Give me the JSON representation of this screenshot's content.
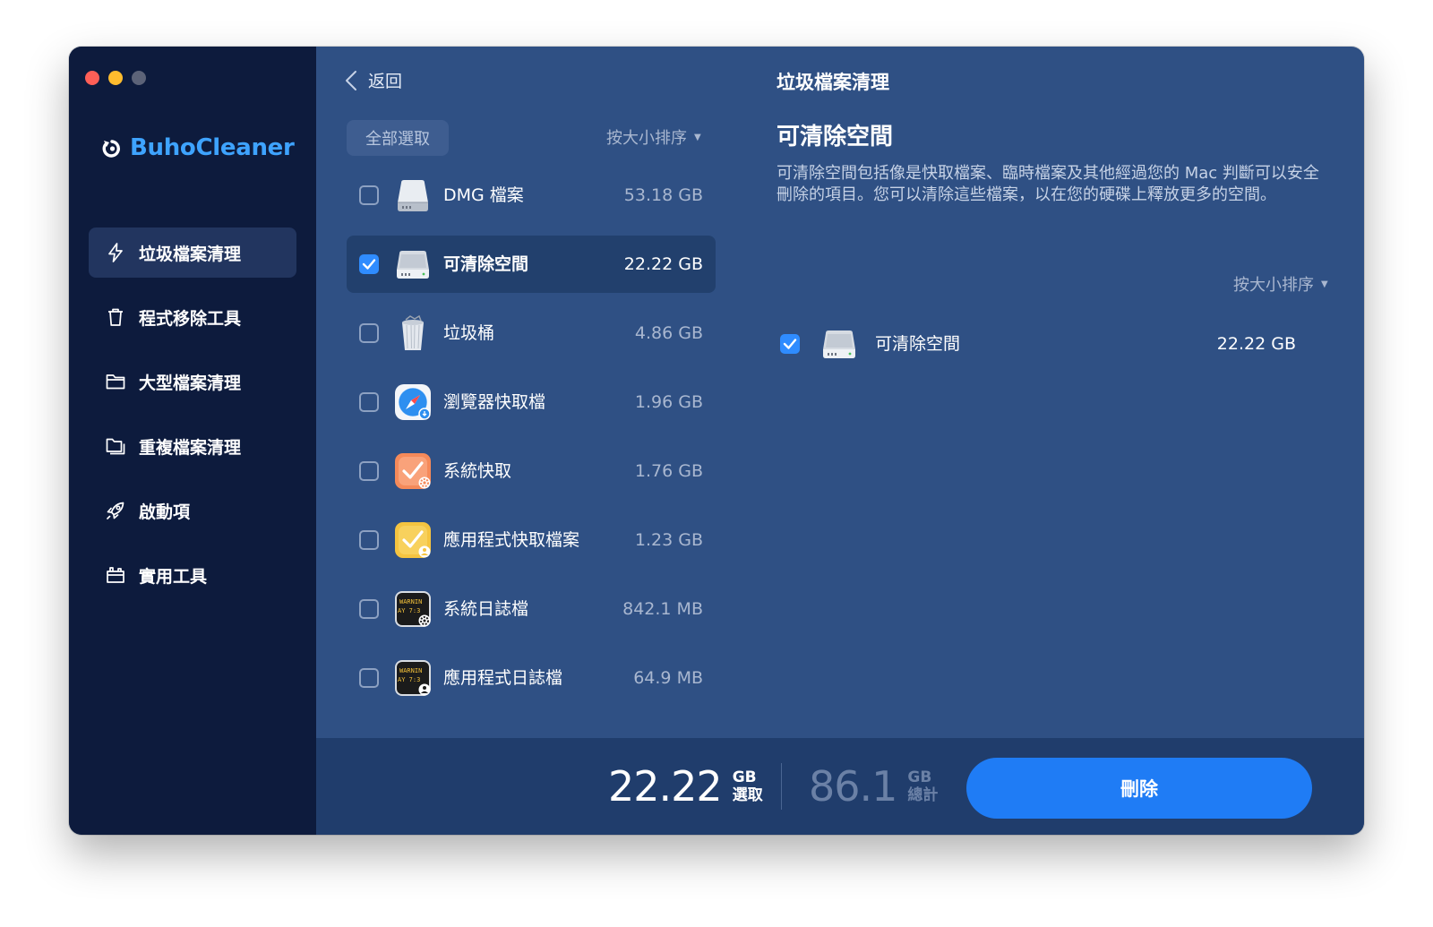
{
  "window": {
    "traffic_lights": [
      "close",
      "minimize",
      "zoom"
    ]
  },
  "brand": {
    "name": "BuhoCleaner",
    "color": "#3ea3ff"
  },
  "sidebar": {
    "items": [
      {
        "label": "垃圾檔案清理",
        "icon": "bolt-icon",
        "active": true
      },
      {
        "label": "程式移除工具",
        "icon": "trash-icon",
        "active": false
      },
      {
        "label": "大型檔案清理",
        "icon": "folder-icon",
        "active": false
      },
      {
        "label": "重複檔案清理",
        "icon": "duplicate-folder-icon",
        "active": false
      },
      {
        "label": "啟動項",
        "icon": "rocket-icon",
        "active": false
      },
      {
        "label": "實用工具",
        "icon": "toolbox-icon",
        "active": false
      }
    ]
  },
  "list_panel": {
    "back_label": "返回",
    "select_all_label": "全部選取",
    "sort_label": "按大小排序",
    "items": [
      {
        "label": "DMG 檔案",
        "size": "53.18 GB",
        "icon": "disk-image-icon",
        "checked": false,
        "selected": false
      },
      {
        "label": "可清除空間",
        "size": "22.22 GB",
        "icon": "hard-drive-icon",
        "checked": true,
        "selected": true
      },
      {
        "label": "垃圾桶",
        "size": "4.86 GB",
        "icon": "trash-can-icon",
        "checked": false,
        "selected": false
      },
      {
        "label": "瀏覽器快取檔",
        "size": "1.96 GB",
        "icon": "safari-icon",
        "checked": false,
        "selected": false
      },
      {
        "label": "系統快取",
        "size": "1.76 GB",
        "icon": "system-cache-icon",
        "checked": false,
        "selected": false
      },
      {
        "label": "應用程式快取檔案",
        "size": "1.23 GB",
        "icon": "app-cache-icon",
        "checked": false,
        "selected": false
      },
      {
        "label": "系統日誌檔",
        "size": "842.1 MB",
        "icon": "system-log-icon",
        "checked": false,
        "selected": false
      },
      {
        "label": "應用程式日誌檔",
        "size": "64.9 MB",
        "icon": "app-log-icon",
        "checked": false,
        "selected": false
      }
    ],
    "log_icon_text": [
      "WARNIN",
      "AY 7:3"
    ]
  },
  "detail_panel": {
    "title": "垃圾檔案清理",
    "heading": "可清除空間",
    "description": "可清除空間包括像是快取檔案、臨時檔案及其他經過您的 Mac 判斷可以安全刪除的項目。您可以清除這些檔案，以在您的硬碟上釋放更多的空間。",
    "sort_label": "按大小排序",
    "item": {
      "label": "可清除空間",
      "size": "22.22 GB",
      "checked": true,
      "icon": "hard-drive-icon"
    }
  },
  "footer": {
    "selected_value": "22.22",
    "selected_unit": "GB",
    "selected_caption": "選取",
    "total_value": "86.1",
    "total_unit": "GB",
    "total_caption": "總計",
    "delete_label": "刪除"
  },
  "colors": {
    "sidebar_bg": "#0d1b3d",
    "content_bg": "#2f5084",
    "footer_bg": "#203d6c",
    "accent": "#1f7cf5",
    "checkbox": "#2f8cff"
  }
}
